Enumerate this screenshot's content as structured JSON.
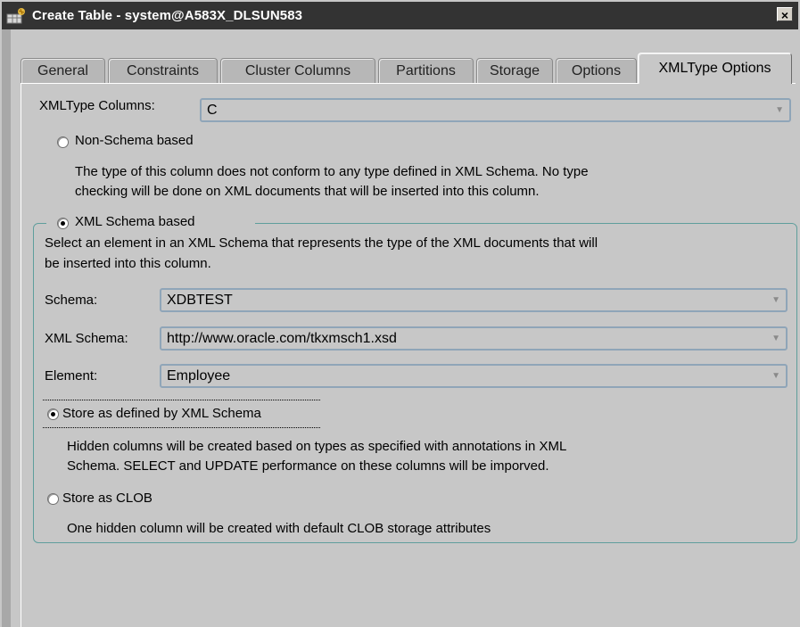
{
  "window": {
    "title": "Create Table - system@A583X_DLSUN583",
    "close_glyph": "×"
  },
  "tabs": [
    {
      "label": "General",
      "active": false
    },
    {
      "label": "Constraints",
      "active": false
    },
    {
      "label": "Cluster Columns",
      "active": false
    },
    {
      "label": "Partitions",
      "active": false
    },
    {
      "label": "Storage",
      "active": false
    },
    {
      "label": "Options",
      "active": false
    },
    {
      "label": "XMLType Options",
      "active": true
    }
  ],
  "xmltype_columns": {
    "label": "XMLType Columns:",
    "value": "C"
  },
  "non_schema": {
    "label": "Non-Schema based",
    "selected": false,
    "description_line1": "The type of this column does not conform to any type defined in XML Schema. No type",
    "description_line2": "checking will be done on XML documents that will be inserted into this column."
  },
  "schema_based": {
    "label": "XML Schema based",
    "selected": true,
    "description_line1": "Select an element in an XML Schema that represents the type of the XML documents that will",
    "description_line2": "be inserted into this column.",
    "schema": {
      "label": "Schema:",
      "value": "XDBTEST"
    },
    "xml_schema": {
      "label": "XML Schema:",
      "value": "http://www.oracle.com/tkxmsch1.xsd"
    },
    "element": {
      "label": "Element:",
      "value": "Employee"
    },
    "store_defined": {
      "label": "Store as defined by XML Schema",
      "selected": true,
      "description_line1": "Hidden columns will be created based on types as specified with annotations in XML",
      "description_line2": "Schema. SELECT and UPDATE performance on these columns will be imporved."
    },
    "store_clob": {
      "label": "Store as CLOB",
      "selected": false,
      "description": "One hidden column will be created with default CLOB storage attributes"
    }
  },
  "icons": {
    "dropdown": "chevron-down-icon",
    "app": "oracle-table-icon"
  }
}
